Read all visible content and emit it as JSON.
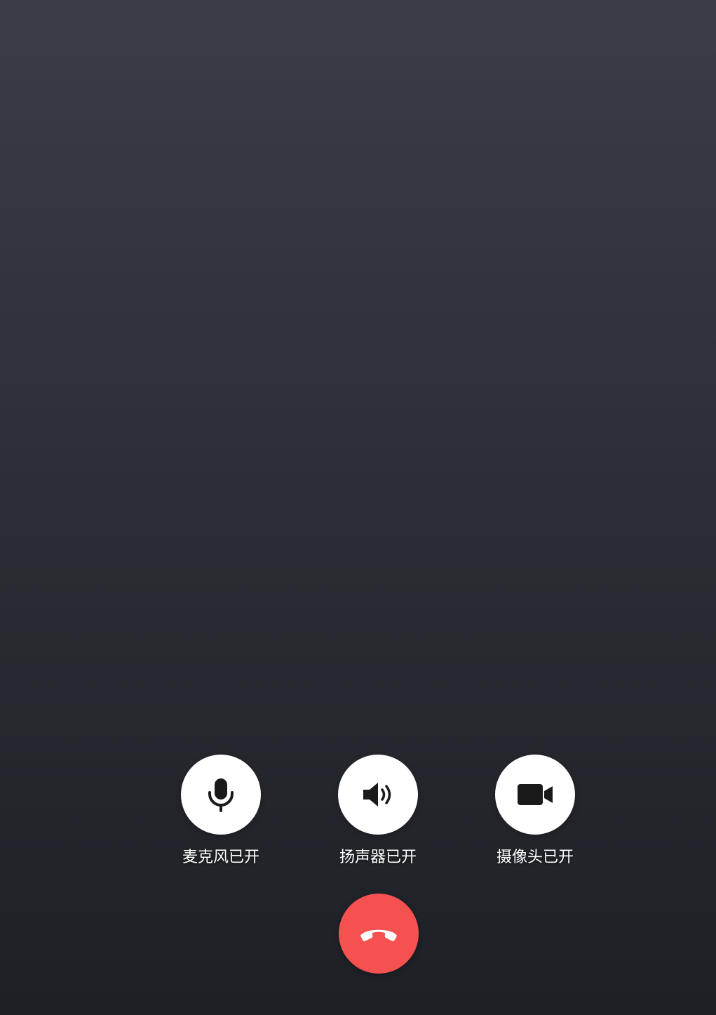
{
  "call": {
    "controls": [
      {
        "id": "mic",
        "label": "麦克风已开",
        "icon": "microphone-icon"
      },
      {
        "id": "speaker",
        "label": "扬声器已开",
        "icon": "speaker-icon"
      },
      {
        "id": "camera",
        "label": "摄像头已开",
        "icon": "video-camera-icon"
      }
    ],
    "hangup_icon": "hang-up-phone-icon",
    "colors": {
      "control_bg": "#ffffff",
      "icon": "#1a1a1a",
      "hangup_bg": "#f55151",
      "label_text": "#ffffff"
    }
  }
}
